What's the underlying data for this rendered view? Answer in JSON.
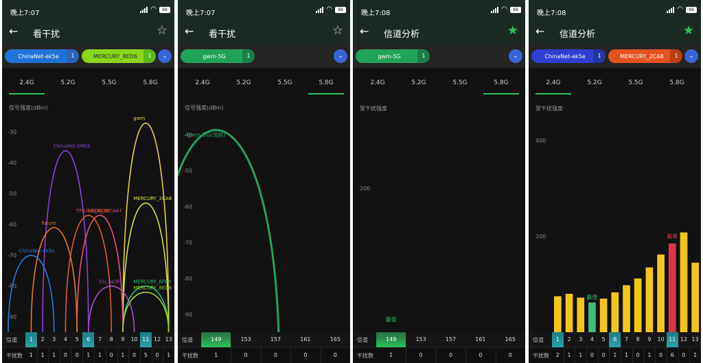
{
  "screens": [
    {
      "status": {
        "time": "晚上7:07",
        "battery": "99"
      },
      "title": "看干扰",
      "starred": false,
      "chips": [
        {
          "label": "ChinaNet-ek5e",
          "count": "1",
          "color": "#1f73d6"
        },
        {
          "label": "MERCURY_8ED6",
          "count": "1",
          "color": "#8ad61f"
        }
      ],
      "bands": [
        "2.4G",
        "5.2G",
        "5.5G",
        "5.8G"
      ],
      "active_band": 0,
      "y_label": "信号强度(dBm)",
      "ticks": [
        "-30",
        "-40",
        "-50",
        "-60",
        "-70",
        "-80",
        "-90"
      ],
      "curve_labels": [
        "ChinaNet-DMzh",
        "gwm",
        "MERCURY_2CA8",
        "USER_3BCA47",
        "TP-LINK_1B2B",
        "future",
        "ChinaNet-ek5e",
        "CU_Se3F",
        "MERCURY_6FB4",
        "MERCURY_8ED6"
      ],
      "channel_row_label": "信道",
      "count_row_label": "干扰数",
      "channels": [
        "1",
        "2",
        "3",
        "4",
        "5",
        "6",
        "7",
        "8",
        "9",
        "10",
        "11",
        "12",
        "13"
      ],
      "counts": [
        "1",
        "1",
        "1",
        "0",
        "0",
        "1",
        "1",
        "0",
        "1",
        "0",
        "5",
        "0",
        "1"
      ]
    },
    {
      "status": {
        "time": "晚上7:07",
        "battery": "99"
      },
      "title": "看干扰",
      "starred": false,
      "chips": [
        {
          "label": "gwm-5G",
          "count": "1",
          "color": "#22a35a"
        }
      ],
      "bands": [
        "2.4G",
        "5.2G",
        "5.5G",
        "5.8G"
      ],
      "active_band": 3,
      "y_label": "信号强度(dBm)",
      "ticks": [
        "-40",
        "-50",
        "-60",
        "-70",
        "-80",
        "-90"
      ],
      "curve_labels": [
        "gwm-5G(当前)"
      ],
      "channel_row_label": "信道",
      "count_row_label": "干扰数",
      "channels": [
        "149",
        "153",
        "157",
        "161",
        "165"
      ],
      "counts": [
        "1",
        "0",
        "0",
        "0",
        "0"
      ]
    },
    {
      "status": {
        "time": "晚上7:08",
        "battery": "99"
      },
      "title": "信道分析",
      "starred": true,
      "chips": [
        {
          "label": "gwm-5G",
          "count": "1",
          "color": "#22a35a"
        }
      ],
      "bands": [
        "2.4G",
        "5.2G",
        "5.5G",
        "5.8G"
      ],
      "active_band": 3,
      "y_label": "受干扰强度",
      "ticks": [
        "200"
      ],
      "best_label": "最佳",
      "channel_row_label": "信道",
      "count_row_label": "干扰数",
      "channels": [
        "149",
        "153",
        "157",
        "161",
        "165"
      ],
      "counts": [
        "1",
        "0",
        "0",
        "0",
        "0"
      ]
    },
    {
      "status": {
        "time": "晚上7:08",
        "battery": "99"
      },
      "title": "信道分析",
      "starred": true,
      "chips": [
        {
          "label": "ChinaNet-ek5e",
          "count": "1",
          "color": "#2f3fcf"
        },
        {
          "label": "MERCURY_2CA8",
          "count": "1",
          "color": "#e2531f"
        }
      ],
      "bands": [
        "2.4G",
        "5.2G",
        "5.5G",
        "5.8G"
      ],
      "active_band": 0,
      "y_label": "受干扰强度",
      "ticks": [
        "400",
        "200"
      ],
      "best_label": "最佳",
      "worst_label": "最差",
      "channel_row_label": "信道",
      "count_row_label": "干扰数",
      "channels": [
        "1",
        "2",
        "3",
        "4",
        "5",
        "6",
        "7",
        "8",
        "9",
        "10",
        "11",
        "12",
        "13"
      ],
      "counts": [
        "2",
        "1",
        "1",
        "0",
        "0",
        "1",
        "1",
        "0",
        "1",
        "0",
        "6",
        "0",
        "1"
      ]
    }
  ],
  "chart_data": [
    {
      "type": "area",
      "title": "",
      "xlabel": "信道",
      "ylabel": "信号强度(dBm)",
      "ylim": [
        -95,
        -25
      ],
      "series": [
        {
          "name": "ChinaNet-DMzh",
          "center_channel": 4,
          "peak_dbm": -36,
          "color": "#8a3fe0"
        },
        {
          "name": "gwm",
          "center_channel": 11,
          "peak_dbm": -27,
          "color": "#e8d23a"
        },
        {
          "name": "MERCURY_2CA8",
          "center_channel": 11,
          "peak_dbm": -53,
          "color": "#d8e23a"
        },
        {
          "name": "USER_3BCA47",
          "center_channel": 7,
          "peak_dbm": -57,
          "color": "#e8507a"
        },
        {
          "name": "TP-LINK_1B2B",
          "center_channel": 6,
          "peak_dbm": -57,
          "color": "#e45a2a"
        },
        {
          "name": "future",
          "center_channel": 3,
          "peak_dbm": -61,
          "color": "#e87a2a"
        },
        {
          "name": "ChinaNet-ek5e",
          "center_channel": 1,
          "peak_dbm": -70,
          "color": "#2a7ae0"
        },
        {
          "name": "CU_Se3F",
          "center_channel": 8,
          "peak_dbm": -80,
          "color": "#b04ad0"
        },
        {
          "name": "MERCURY_6FB4",
          "center_channel": 11,
          "peak_dbm": -80,
          "color": "#2ac27a"
        },
        {
          "name": "MERCURY_8ED6",
          "center_channel": 11,
          "peak_dbm": -82,
          "color": "#9ad62a"
        }
      ]
    },
    {
      "type": "area",
      "title": "",
      "xlabel": "信道",
      "ylabel": "信号强度(dBm)",
      "ylim": [
        -95,
        -35
      ],
      "series": [
        {
          "name": "gwm-5G(当前)",
          "center_channel": 149,
          "peak_dbm": -41,
          "color": "#22a35a"
        }
      ]
    },
    {
      "type": "bar",
      "title": "",
      "xlabel": "信道",
      "ylabel": "受干扰强度",
      "categories": [
        "149",
        "153",
        "157",
        "161",
        "165"
      ],
      "values": [
        0,
        0,
        0,
        0,
        0
      ],
      "ylim": [
        0,
        300
      ]
    },
    {
      "type": "bar",
      "title": "",
      "xlabel": "信道",
      "ylabel": "受干扰强度",
      "categories": [
        "1",
        "2",
        "3",
        "4",
        "5",
        "6",
        "7",
        "8",
        "9",
        "10",
        "11",
        "12",
        "13"
      ],
      "values": [
        75,
        80,
        72,
        62,
        70,
        83,
        98,
        112,
        135,
        162,
        185,
        208,
        145
      ],
      "ylim": [
        0,
        450
      ],
      "best_index": 3,
      "worst_index": 10
    }
  ]
}
